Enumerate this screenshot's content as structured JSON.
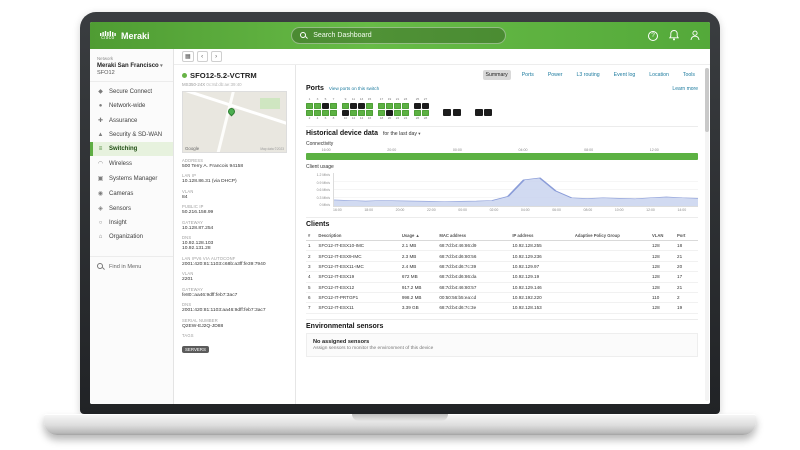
{
  "header": {
    "logo_primary": "cisco",
    "logo_secondary": "Meraki",
    "search_placeholder": "Search Dashboard"
  },
  "sidebar": {
    "network_label": "Network",
    "network_name": "Meraki San Francisco",
    "network_sub": "SFO12",
    "items": [
      {
        "label": "Secure Connect",
        "icon": "lock"
      },
      {
        "label": "Network-wide",
        "icon": "globe"
      },
      {
        "label": "Assurance",
        "icon": "pulse"
      },
      {
        "label": "Security & SD-WAN",
        "icon": "shield"
      },
      {
        "label": "Switching",
        "icon": "switch",
        "active": true
      },
      {
        "label": "Wireless",
        "icon": "wifi"
      },
      {
        "label": "Systems Manager",
        "icon": "devices"
      },
      {
        "label": "Cameras",
        "icon": "camera"
      },
      {
        "label": "Sensors",
        "icon": "sensor"
      },
      {
        "label": "Insight",
        "icon": "insight"
      },
      {
        "label": "Organization",
        "icon": "building"
      }
    ],
    "find_in_menu": "Find in Menu"
  },
  "toolbar": {
    "list_icon": "▦",
    "back": "‹",
    "forward": "›"
  },
  "device": {
    "name": "SFO12-5.2-VCTRM",
    "model": "MS350-24X",
    "mac": "0c:8d:db:ae:39:40",
    "status_color": "#67b346",
    "map": {
      "brand": "Google",
      "attribution": "Map data ©2023"
    },
    "details": [
      {
        "label": "ADDRESS",
        "value": "500 Terry A. Francois 94158"
      },
      {
        "label": "LAN IP",
        "value": "10.128.86.31 (via DHCP)"
      },
      {
        "label": "VLAN",
        "value": "84"
      },
      {
        "label": "PUBLIC IP",
        "value": "50.216.158.99"
      },
      {
        "label": "GATEWAY",
        "value": "10.128.87.254"
      },
      {
        "label": "DNS",
        "value": "10.92.128.103\n10.92.131.28"
      },
      {
        "label": "LAN IPV6 VIA AUTOCONF",
        "value": "2001:420:81:1103:c68b:a3ff:fe39:7940"
      },
      {
        "label": "VLAN",
        "value": "2201"
      },
      {
        "label": "GATEWAY",
        "value": "fe80::aa46:9dff:feb7:3ac7"
      },
      {
        "label": "DNS",
        "value": "2001:420:81:1103:aa46:9dff:feb7:3ac7"
      },
      {
        "label": "SERIAL NUMBER",
        "value": "Q2EW-EJ2Q-JD88"
      },
      {
        "label": "TAGS",
        "value": "SERVERS",
        "badge": true
      }
    ]
  },
  "tabs": {
    "items": [
      "Summary",
      "Ports",
      "Power",
      "L3 routing",
      "Event log",
      "Location",
      "Tools"
    ],
    "active": "Summary"
  },
  "ports_section": {
    "title": "Ports",
    "view_link": "View ports on this switch",
    "learn_more": "Learn more",
    "main_top": [
      1,
      1,
      0,
      1,
      1,
      0,
      0,
      1,
      1,
      1,
      1,
      1
    ],
    "main_bottom": [
      1,
      1,
      1,
      1,
      0,
      1,
      1,
      1,
      1,
      0,
      1,
      1
    ],
    "aux_top": [
      0,
      0
    ],
    "aux_bottom": [
      1,
      1
    ],
    "modules": [
      [
        0,
        0
      ],
      [
        0,
        0
      ]
    ]
  },
  "historical": {
    "title": "Historical device data",
    "range": "for the last day",
    "connectivity_label": "Connectivity",
    "connectivity_color": "#5cb143",
    "times": [
      "16:00",
      "20:00",
      "00:00",
      "04:00",
      "08:00",
      "12:00"
    ],
    "usage_label": "Client usage"
  },
  "chart_data": {
    "type": "area",
    "title": "Client usage",
    "ylabel": "Mb/s",
    "ylim": [
      0,
      1.2
    ],
    "ytick_labels": [
      "1.2 Mb/s",
      "0.9 Mb/s",
      "0.6 Mb/s",
      "0.3 Mb/s",
      "0 Mb/s"
    ],
    "xticks": [
      "16:00",
      "18:00",
      "20:00",
      "22:00",
      "00:00",
      "02:00",
      "04:00",
      "06:00",
      "08:00",
      "10:00",
      "12:00",
      "14:00"
    ],
    "x": [
      "16:00",
      "17:00",
      "18:00",
      "19:00",
      "20:00",
      "21:00",
      "22:00",
      "23:00",
      "00:00",
      "01:00",
      "02:00",
      "03:00",
      "04:00",
      "05:00",
      "06:00",
      "07:00",
      "08:00",
      "09:00",
      "10:00",
      "11:00",
      "12:00",
      "13:00",
      "14:00",
      "15:00"
    ],
    "values": [
      0.22,
      0.2,
      0.18,
      0.2,
      0.19,
      0.18,
      0.17,
      0.16,
      0.17,
      0.18,
      0.2,
      0.35,
      0.95,
      1.02,
      0.55,
      0.3,
      0.27,
      0.3,
      0.28,
      0.26,
      0.3,
      0.33,
      0.3,
      0.28
    ],
    "line_color": "#8a9cd8",
    "fill_color": "#c9d3ef"
  },
  "clients": {
    "title": "Clients",
    "columns": [
      "#",
      "Description",
      "Usage ▲",
      "MAC address",
      "IP address",
      "Adaptive Policy Group",
      "VLAN",
      "Port"
    ],
    "rows": [
      {
        "num": "1",
        "description": "SFO12-IT-ESX10-IMC",
        "usage": "2.1 MB",
        "mac": "68:7d:b4:46:86:d9",
        "ip": "10.92.128.255",
        "apg": "",
        "vlan": "128",
        "port": "18"
      },
      {
        "num": "2",
        "description": "SFO12-IT-ESX9-IMC",
        "usage": "2.3 MB",
        "mac": "68:7d:b4:d6:80:56",
        "ip": "10.92.129.236",
        "apg": "",
        "vlan": "128",
        "port": "21"
      },
      {
        "num": "3",
        "description": "SFO12-IT-ESX11-IMC",
        "usage": "2.4 MB",
        "mac": "68:7d:b4:d6:7c:39",
        "ip": "10.92.129.97",
        "apg": "",
        "vlan": "128",
        "port": "20"
      },
      {
        "num": "4",
        "description": "SFO12-IT-ESX19",
        "usage": "672 MB",
        "mac": "68:7d:b4:d6:86:da",
        "ip": "10.92.129.19",
        "apg": "",
        "vlan": "128",
        "port": "17"
      },
      {
        "num": "5",
        "description": "SFO12-IT-ESX12",
        "usage": "917.2 MB",
        "mac": "68:7d:b4:46:80:57",
        "ip": "10.92.129.146",
        "apg": "",
        "vlan": "128",
        "port": "21"
      },
      {
        "num": "6",
        "description": "SFO12-IT-PRTGP1",
        "usage": "998.2 MB",
        "mac": "00:50:56:b5:ea:cd",
        "ip": "10.92.192.220",
        "apg": "",
        "vlan": "110",
        "port": "2"
      },
      {
        "num": "7",
        "description": "SFO12-IT-ESX11",
        "usage": "3.39 GB",
        "mac": "68:7d:b4:d6:7c:3e",
        "ip": "10.92.128.153",
        "apg": "",
        "vlan": "128",
        "port": "19"
      }
    ]
  },
  "sensors": {
    "title": "Environmental sensors",
    "empty_title": "No assigned sensors",
    "empty_sub": "Assign sensors to monitor the environment of this device"
  }
}
